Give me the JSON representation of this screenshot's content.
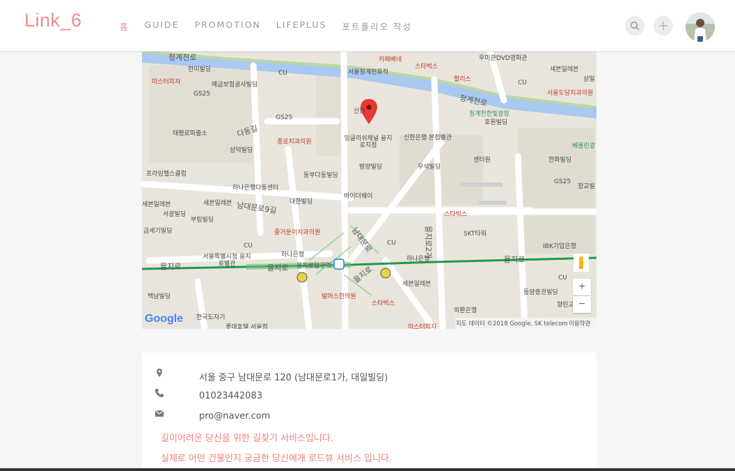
{
  "header": {
    "brand": "Link_6",
    "nav": [
      {
        "label": "홈",
        "active": true
      },
      {
        "label": "GUIDE"
      },
      {
        "label": "PROMOTION"
      },
      {
        "label": "LIFEPLUS"
      },
      {
        "label": "포트폴리오 작성"
      }
    ]
  },
  "map": {
    "logo": "Google",
    "attribution": "지도 데이터 ©2018 Google, SK telecom",
    "terms": "이용약관",
    "zoom_in": "+",
    "zoom_out": "−",
    "labels": [
      "청계천로",
      "한미빌딩",
      "미스터피자",
      "예금보험공사빌딩",
      "GS25",
      "CU",
      "서울청계천유적",
      "카페베네",
      "스타벅스",
      "할리스",
      "우미관DVD영화관",
      "세븐일레븐",
      "삼일",
      "CU",
      "서울도담치과의원",
      "청계천로",
      "청계천한빛광장",
      "호원빌딩",
      "신한",
      "잉글리쉬채널 을지로지점",
      "신한은행 본점별관",
      "GS25",
      "종로치과의원",
      "다동길",
      "태평로파출소",
      "삼덕빌딩",
      "범양빌딩",
      "우석빌딩",
      "센터원",
      "한화빌딩",
      "베를린광",
      "GS25",
      "장교빌",
      "프라임헬스클럽",
      "동부다동빌딩",
      "하나은행다동센터",
      "바이더웨이",
      "세븐일레븐",
      "세븐일레븐",
      "남대문로9길",
      "대한빌딩",
      "서광빌딩",
      "부림빌딩",
      "스타벅스",
      "금세기빌딩",
      "즐거운이치과의원",
      "SKT타워",
      "을지로2가",
      "CU",
      "하나은행",
      "CU",
      "IBK기업은행",
      "서울특별시청 을지로별관",
      "남대문로",
      "을지로입구역",
      "하나은행",
      "을지로",
      "을지로",
      "을지로",
      "을지로",
      "세븐일레븐",
      "CU",
      "백남빌딩",
      "발머스한의원",
      "스타벅스",
      "동양증권빌딩",
      "향린교",
      "한국도자기",
      "외환은행",
      "롯데호텔 서울점",
      "미스터피자"
    ]
  },
  "contact": {
    "address": "서울 중구 남대문로 120 (남대문로1가, 대일빌딩)",
    "phone": "01023442083",
    "email": "pro@naver.com"
  },
  "notices": [
    "길이어려운 당신을 위한 길찾기 서비스입니다.",
    "실제로 어떤 건물인지 궁금한 당신에게 로드뷰 서비스 입니다."
  ],
  "colors": {
    "accent": "#f08c8c",
    "notice": "#f08080",
    "map_bg": "#eae6df",
    "stream": "#a9c9f0",
    "subway": "#1e9a4b"
  },
  "icons": {
    "search": "search-icon",
    "add": "plus-icon",
    "location": "map-marker-icon",
    "phone": "phone-icon",
    "email": "envelope-icon"
  }
}
